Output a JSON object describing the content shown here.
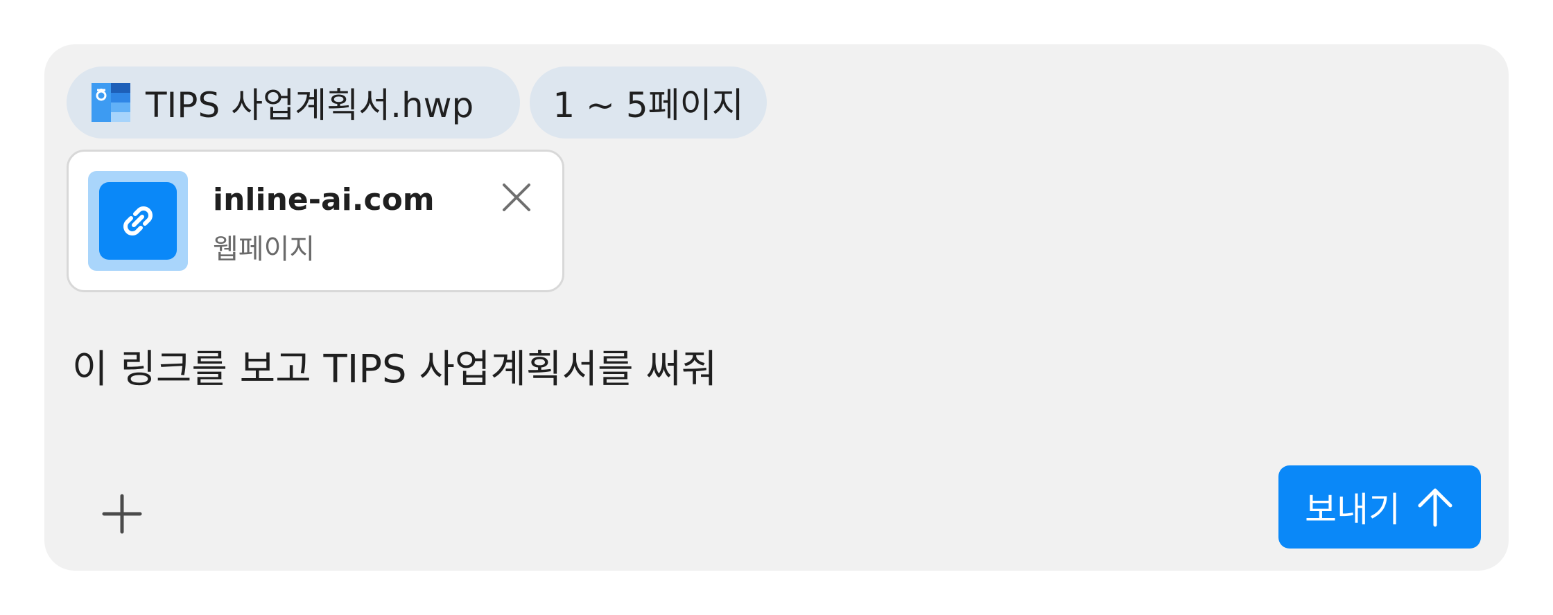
{
  "attachments": {
    "file": {
      "name": "TIPS 사업계획서.hwp",
      "icon": "hwp-file-icon"
    },
    "page_range": "1 ~ 5페이지"
  },
  "link_card": {
    "title": "inline-ai.com",
    "subtitle": "웹페이지",
    "icon": "link-icon",
    "close_icon": "close-icon"
  },
  "message": {
    "text": "이 링크를 보고 TIPS 사업계획서를 써줘"
  },
  "toolbar": {
    "add_icon": "plus-icon",
    "send_label": "보내기",
    "send_icon": "arrow-up-icon"
  },
  "colors": {
    "accent": "#0a88f8",
    "chip_bg": "#dde6ef",
    "composer_bg": "#f1f1f1"
  }
}
